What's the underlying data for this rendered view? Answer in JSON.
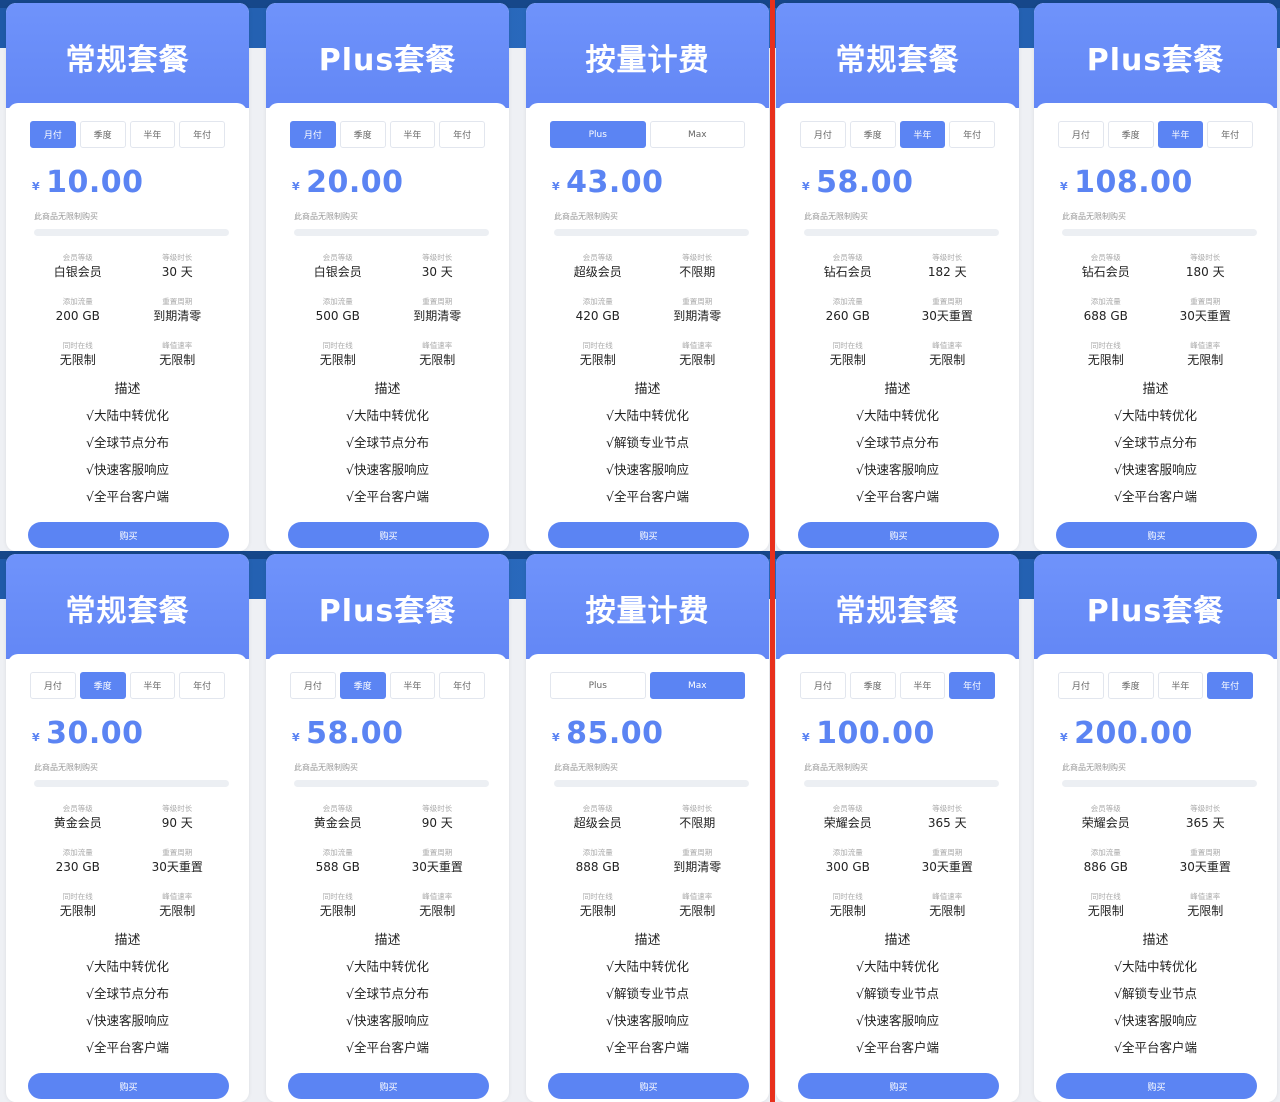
{
  "labels": {
    "limit_text": "此商品无限制购买",
    "level_key": "会员等级",
    "duration_key": "等级时长",
    "traffic_key": "添加流量",
    "reset_key": "重置周期",
    "online_key": "同时在线",
    "speed_key": "峰值速率",
    "desc_title": "描述",
    "buy_label": "购买",
    "currency": "¥"
  },
  "cards": [
    {
      "title": "常规套餐",
      "periods": [
        "月付",
        "季度",
        "半年",
        "年付"
      ],
      "active": 0,
      "price": "10.00",
      "level": "白银会员",
      "duration": "30 天",
      "traffic": "200 GB",
      "reset": "到期清零",
      "online": "无限制",
      "speed": "无限制",
      "features": [
        "√大陆中转优化",
        "√全球节点分布",
        "√快速客服响应",
        "√全平台客户端"
      ]
    },
    {
      "title": "Plus套餐",
      "periods": [
        "月付",
        "季度",
        "半年",
        "年付"
      ],
      "active": 0,
      "price": "20.00",
      "level": "白银会员",
      "duration": "30 天",
      "traffic": "500 GB",
      "reset": "到期清零",
      "online": "无限制",
      "speed": "无限制",
      "features": [
        "√大陆中转优化",
        "√全球节点分布",
        "√快速客服响应",
        "√全平台客户端"
      ]
    },
    {
      "title": "按量计费",
      "periods": [
        "Plus",
        "Max"
      ],
      "active": 0,
      "price": "43.00",
      "level": "超级会员",
      "duration": "不限期",
      "traffic": "420 GB",
      "reset": "到期清零",
      "online": "无限制",
      "speed": "无限制",
      "features": [
        "√大陆中转优化",
        "√解锁专业节点",
        "√快速客服响应",
        "√全平台客户端"
      ]
    },
    {
      "title": "常规套餐",
      "periods": [
        "月付",
        "季度",
        "半年",
        "年付"
      ],
      "active": 2,
      "price": "58.00",
      "level": "钻石会员",
      "duration": "182 天",
      "traffic": "260 GB",
      "reset": "30天重置",
      "online": "无限制",
      "speed": "无限制",
      "features": [
        "√大陆中转优化",
        "√全球节点分布",
        "√快速客服响应",
        "√全平台客户端"
      ]
    },
    {
      "title": "Plus套餐",
      "periods": [
        "月付",
        "季度",
        "半年",
        "年付"
      ],
      "active": 2,
      "price": "108.00",
      "level": "钻石会员",
      "duration": "180 天",
      "traffic": "688 GB",
      "reset": "30天重置",
      "online": "无限制",
      "speed": "无限制",
      "features": [
        "√大陆中转优化",
        "√全球节点分布",
        "√快速客服响应",
        "√全平台客户端"
      ]
    },
    {
      "title": "常规套餐",
      "periods": [
        "月付",
        "季度",
        "半年",
        "年付"
      ],
      "active": 1,
      "price": "30.00",
      "level": "黄金会员",
      "duration": "90 天",
      "traffic": "230 GB",
      "reset": "30天重置",
      "online": "无限制",
      "speed": "无限制",
      "features": [
        "√大陆中转优化",
        "√全球节点分布",
        "√快速客服响应",
        "√全平台客户端"
      ]
    },
    {
      "title": "Plus套餐",
      "periods": [
        "月付",
        "季度",
        "半年",
        "年付"
      ],
      "active": 1,
      "price": "58.00",
      "level": "黄金会员",
      "duration": "90 天",
      "traffic": "588 GB",
      "reset": "30天重置",
      "online": "无限制",
      "speed": "无限制",
      "features": [
        "√大陆中转优化",
        "√全球节点分布",
        "√快速客服响应",
        "√全平台客户端"
      ]
    },
    {
      "title": "按量计费",
      "periods": [
        "Plus",
        "Max"
      ],
      "active": 1,
      "price": "85.00",
      "level": "超级会员",
      "duration": "不限期",
      "traffic": "888 GB",
      "reset": "到期清零",
      "online": "无限制",
      "speed": "无限制",
      "features": [
        "√大陆中转优化",
        "√解锁专业节点",
        "√快速客服响应",
        "√全平台客户端"
      ]
    },
    {
      "title": "常规套餐",
      "periods": [
        "月付",
        "季度",
        "半年",
        "年付"
      ],
      "active": 3,
      "price": "100.00",
      "level": "荣耀会员",
      "duration": "365 天",
      "traffic": "300 GB",
      "reset": "30天重置",
      "online": "无限制",
      "speed": "无限制",
      "features": [
        "√大陆中转优化",
        "√解锁专业节点",
        "√快速客服响应",
        "√全平台客户端"
      ]
    },
    {
      "title": "Plus套餐",
      "periods": [
        "月付",
        "季度",
        "半年",
        "年付"
      ],
      "active": 3,
      "price": "200.00",
      "level": "荣耀会员",
      "duration": "365 天",
      "traffic": "886 GB",
      "reset": "30天重置",
      "online": "无限制",
      "speed": "无限制",
      "features": [
        "√大陆中转优化",
        "√解锁专业节点",
        "√快速客服响应",
        "√全平台客户端"
      ]
    }
  ]
}
